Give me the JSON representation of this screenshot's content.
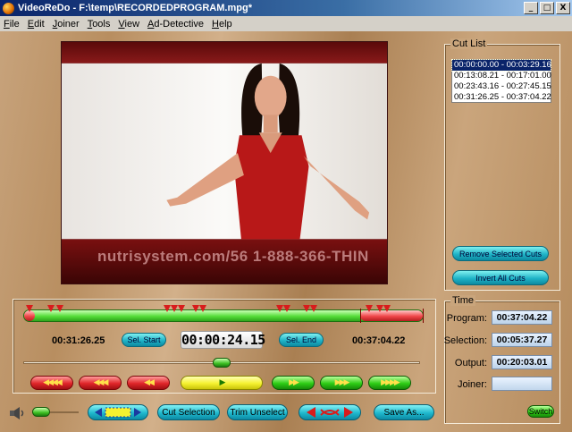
{
  "window": {
    "title": "VideoReDo - F:\\temp\\RECORDEDPROGRAM.mpg*",
    "minimize": "_",
    "maximize": "□",
    "close": "X"
  },
  "menu": [
    "File",
    "Edit",
    "Joiner",
    "Tools",
    "View",
    "Ad-Detective",
    "Help"
  ],
  "video": {
    "caption": "nutrisystem.com/56   1-888-366-THIN"
  },
  "cut_list": {
    "legend": "Cut List",
    "items": [
      "00:00:00.00 - 00:03:29.16",
      "00:13:08.21 - 00:17:01.00",
      "00:23:43.16 - 00:27:45.15",
      "00:31:26.25 - 00:37:04.22"
    ],
    "selected_index": 0,
    "remove_label": "Remove Selected Cuts",
    "invert_label": "Invert All Cuts"
  },
  "time_panel": {
    "legend": "Time",
    "program_label": "Program:",
    "program_value": "00:37:04.22",
    "selection_label": "Selection:",
    "selection_value": "00:05:37.27",
    "output_label": "Output:",
    "output_value": "00:20:03.01",
    "joiner_label": "Joiner:",
    "joiner_value": "",
    "switch_label": "Switch"
  },
  "controls": {
    "sel_start_time": "00:31:26.25",
    "sel_start_label": "Sel. Start",
    "current_time": "00:00:24.15",
    "sel_end_label": "Sel. End",
    "sel_end_time": "00:37:04.22",
    "scrub_position": 0.5,
    "volume_level": 0.25
  },
  "nav_buttons": {
    "back_4": "◀◀◀◀",
    "back_3": "◀◀◀",
    "back_2": "◀◀",
    "play": "▶",
    "fwd_2": "▶▶",
    "fwd_3": "▶▶▶",
    "fwd_4": "▶▶▶▶"
  },
  "bottom": {
    "cut_selection": "Cut Selection",
    "trim_unselect": "Trim Unselect",
    "save_as": "Save As..."
  },
  "colors": {
    "accent_cyan": "#1fb3c7",
    "nav_red": "#e0262a",
    "nav_green": "#2ecc16",
    "timeline_green": "#55dd39",
    "titlebar": "#0a246a"
  }
}
